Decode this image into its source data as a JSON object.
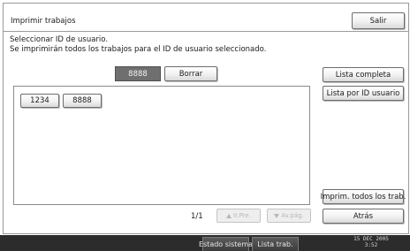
{
  "title": "Imprimir trabajos",
  "exit_label": "Salir",
  "instructions": {
    "line1": "Seleccionar ID de usuario.",
    "line2": "Se imprimirán todos los trabajos para el ID de usuario seleccionado."
  },
  "id_entry": {
    "value": "8888",
    "clear_label": "Borrar"
  },
  "user_ids": [
    "1234",
    "8888"
  ],
  "side_buttons": {
    "full_list": "Lista completa",
    "list_by_user": "Lista por ID usuario",
    "print_all": "Imprim. todos los trab.",
    "back": "Atrás"
  },
  "pagination": {
    "indicator": "1/1",
    "prev_label": "Ir.Pre.",
    "next_label": "Av.pág."
  },
  "status_bar": {
    "system_status": "Estado sistema",
    "job_list": "Lista trab.",
    "date": "15 DEC  2005",
    "time": "3:52"
  }
}
